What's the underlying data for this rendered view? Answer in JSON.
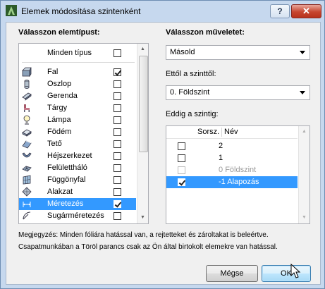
{
  "window": {
    "title": "Elemek módosítása szintenként",
    "help_label": "?",
    "close_label": "✕"
  },
  "left": {
    "heading": "Válasszon elemtípust:",
    "all_label": "Minden típus",
    "items": [
      {
        "label": "Fal",
        "checked": true,
        "icon": "wall-icon"
      },
      {
        "label": "Oszlop",
        "checked": false,
        "icon": "column-icon"
      },
      {
        "label": "Gerenda",
        "checked": false,
        "icon": "beam-icon"
      },
      {
        "label": "Tárgy",
        "checked": false,
        "icon": "object-icon"
      },
      {
        "label": "Lámpa",
        "checked": false,
        "icon": "lamp-icon"
      },
      {
        "label": "Födém",
        "checked": false,
        "icon": "slab-icon"
      },
      {
        "label": "Tető",
        "checked": false,
        "icon": "roof-icon"
      },
      {
        "label": "Héjszerkezet",
        "checked": false,
        "icon": "shell-icon"
      },
      {
        "label": "Felülettháló",
        "checked": false,
        "icon": "mesh-icon"
      },
      {
        "label": "Függönyfal",
        "checked": false,
        "icon": "curtainwall-icon"
      },
      {
        "label": "Alakzat",
        "checked": false,
        "icon": "morph-icon"
      },
      {
        "label": "Méretezés",
        "checked": true,
        "selected": true,
        "icon": "dimension-icon"
      },
      {
        "label": "Sugárméretezés",
        "checked": false,
        "icon": "radial-dimension-icon"
      }
    ]
  },
  "right": {
    "operation_heading": "Válasszon műveletet:",
    "operation_value": "Másold",
    "from_heading": "Ettől a szinttől:",
    "from_value": "0. Földszint",
    "to_heading": "Eddig a szintig:",
    "col_num": "Sorsz.",
    "col_name": "Név",
    "stories": [
      {
        "num": "2",
        "name": "",
        "state": "normal"
      },
      {
        "num": "1",
        "name": "",
        "state": "normal"
      },
      {
        "num": "0",
        "name": "Földszint",
        "state": "disabled"
      },
      {
        "num": "-1",
        "name": "Alapozás",
        "state": "selected"
      }
    ]
  },
  "notes": {
    "line1": "Megjegyzés: Minden fóliára hatással van, a rejtetteket és zároltakat is beleértve.",
    "line2": "Csapatmunkában a Töröl parancs csak az Ön által birtokolt elemekre van hatással."
  },
  "buttons": {
    "cancel": "Mégse",
    "ok": "OK"
  },
  "colors": {
    "selection": "#3399ff",
    "titlebar": "#c6d8ee",
    "close": "#c6452f"
  }
}
